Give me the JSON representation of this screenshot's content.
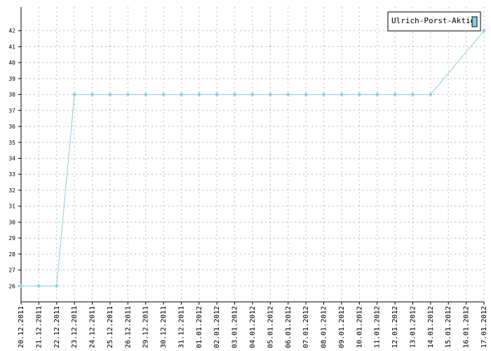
{
  "chart_data": {
    "type": "line",
    "title": "",
    "xlabel": "",
    "ylabel": "",
    "categories": [
      "20.12.2011",
      "21.12.2011",
      "22.12.2011",
      "23.12.2011",
      "24.12.2011",
      "25.12.2011",
      "26.12.2011",
      "29.12.2011",
      "30.12.2011",
      "31.12.2011",
      "01.01.2012",
      "02.01.2012",
      "03.01.2012",
      "04.01.2012",
      "05.01.2012",
      "06.01.2012",
      "07.01.2012",
      "08.01.2012",
      "09.01.2012",
      "10.01.2012",
      "11.01.2012",
      "12.01.2012",
      "13.01.2012",
      "14.01.2012",
      "15.01.2012",
      "16.01.2012",
      "17.01.2012"
    ],
    "series": [
      {
        "name": "Ulrich-Porst-Aktie",
        "color": "#87ceeb",
        "values": [
          26,
          26,
          26,
          38,
          38,
          38,
          38,
          38,
          38,
          38,
          38,
          38,
          38,
          38,
          38,
          38,
          38,
          38,
          38,
          38,
          38,
          38,
          38,
          38,
          null,
          null,
          42
        ]
      }
    ],
    "yticks": [
      26,
      27,
      28,
      29,
      30,
      31,
      32,
      33,
      34,
      35,
      36,
      37,
      38,
      39,
      40,
      41,
      42
    ],
    "ylim": [
      25,
      43
    ],
    "grid": true,
    "legend_position": "top-right"
  }
}
